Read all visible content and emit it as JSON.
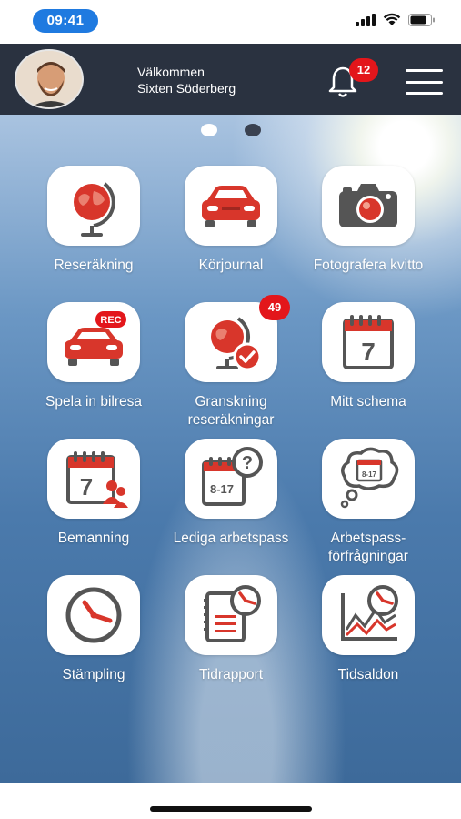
{
  "status_bar": {
    "time": "09:41",
    "signal_icon": "cellular-signal-icon",
    "wifi_icon": "wifi-icon",
    "battery_icon": "battery-icon"
  },
  "header": {
    "greeting": "Välkommen",
    "user_name": "Sixten Söderberg",
    "notification_count": "12",
    "bell_icon": "bell-icon",
    "menu_icon": "hamburger-menu-icon"
  },
  "pager": {
    "active_page": 1,
    "total_pages": 2
  },
  "tiles": [
    {
      "label": "Reseräkning",
      "icon": "globe-icon"
    },
    {
      "label": "Körjournal",
      "icon": "car-icon"
    },
    {
      "label": "Fotografera kvitto",
      "icon": "camera-icon"
    },
    {
      "label": "Spela in bilresa",
      "icon": "car-record-icon",
      "icon_text": "REC"
    },
    {
      "label": "Granskning reseräkningar",
      "icon": "globe-check-icon",
      "badge": "49"
    },
    {
      "label": "Mitt schema",
      "icon": "calendar-icon",
      "icon_text": "7"
    },
    {
      "label": "Bemanning",
      "icon": "calendar-people-icon",
      "icon_text": "7"
    },
    {
      "label": "Lediga arbetspass",
      "icon": "calendar-question-icon",
      "icon_text": "8-17"
    },
    {
      "label": "Arbetspass-förfrågningar",
      "icon": "calendar-thought-icon",
      "icon_text": "8-17"
    },
    {
      "label": "Stämpling",
      "icon": "clock-icon"
    },
    {
      "label": "Tidrapport",
      "icon": "timesheet-clock-icon"
    },
    {
      "label": "Tidsaldon",
      "icon": "chart-clock-icon"
    }
  ],
  "colors": {
    "accent_red": "#e3161b",
    "icon_red": "#d8362b",
    "icon_gray": "#555555",
    "header_bg": "#2a3240"
  }
}
